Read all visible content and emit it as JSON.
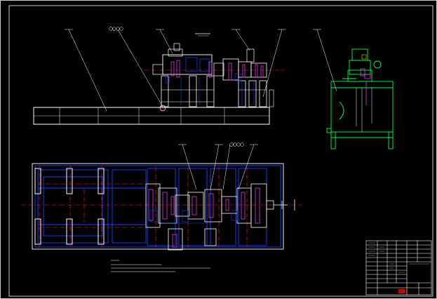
{
  "title": "",
  "drawing_title_block": {
    "rows": 14,
    "stamp_color": "#cc0000"
  },
  "colors": {
    "background": "#000000",
    "frame": "#ffffff",
    "part_outline": "#ffffff",
    "hidden_parts": "#2040ff",
    "centerlines": "#ff2020",
    "hydraulic_tank": "#00ff40",
    "accent_magenta": "#ff40ff",
    "leaders": "#ffffff"
  },
  "views": [
    "front-elevation",
    "plan-view",
    "hydraulic-station"
  ],
  "balloons": {
    "top_group": "",
    "bottom_group": ""
  }
}
